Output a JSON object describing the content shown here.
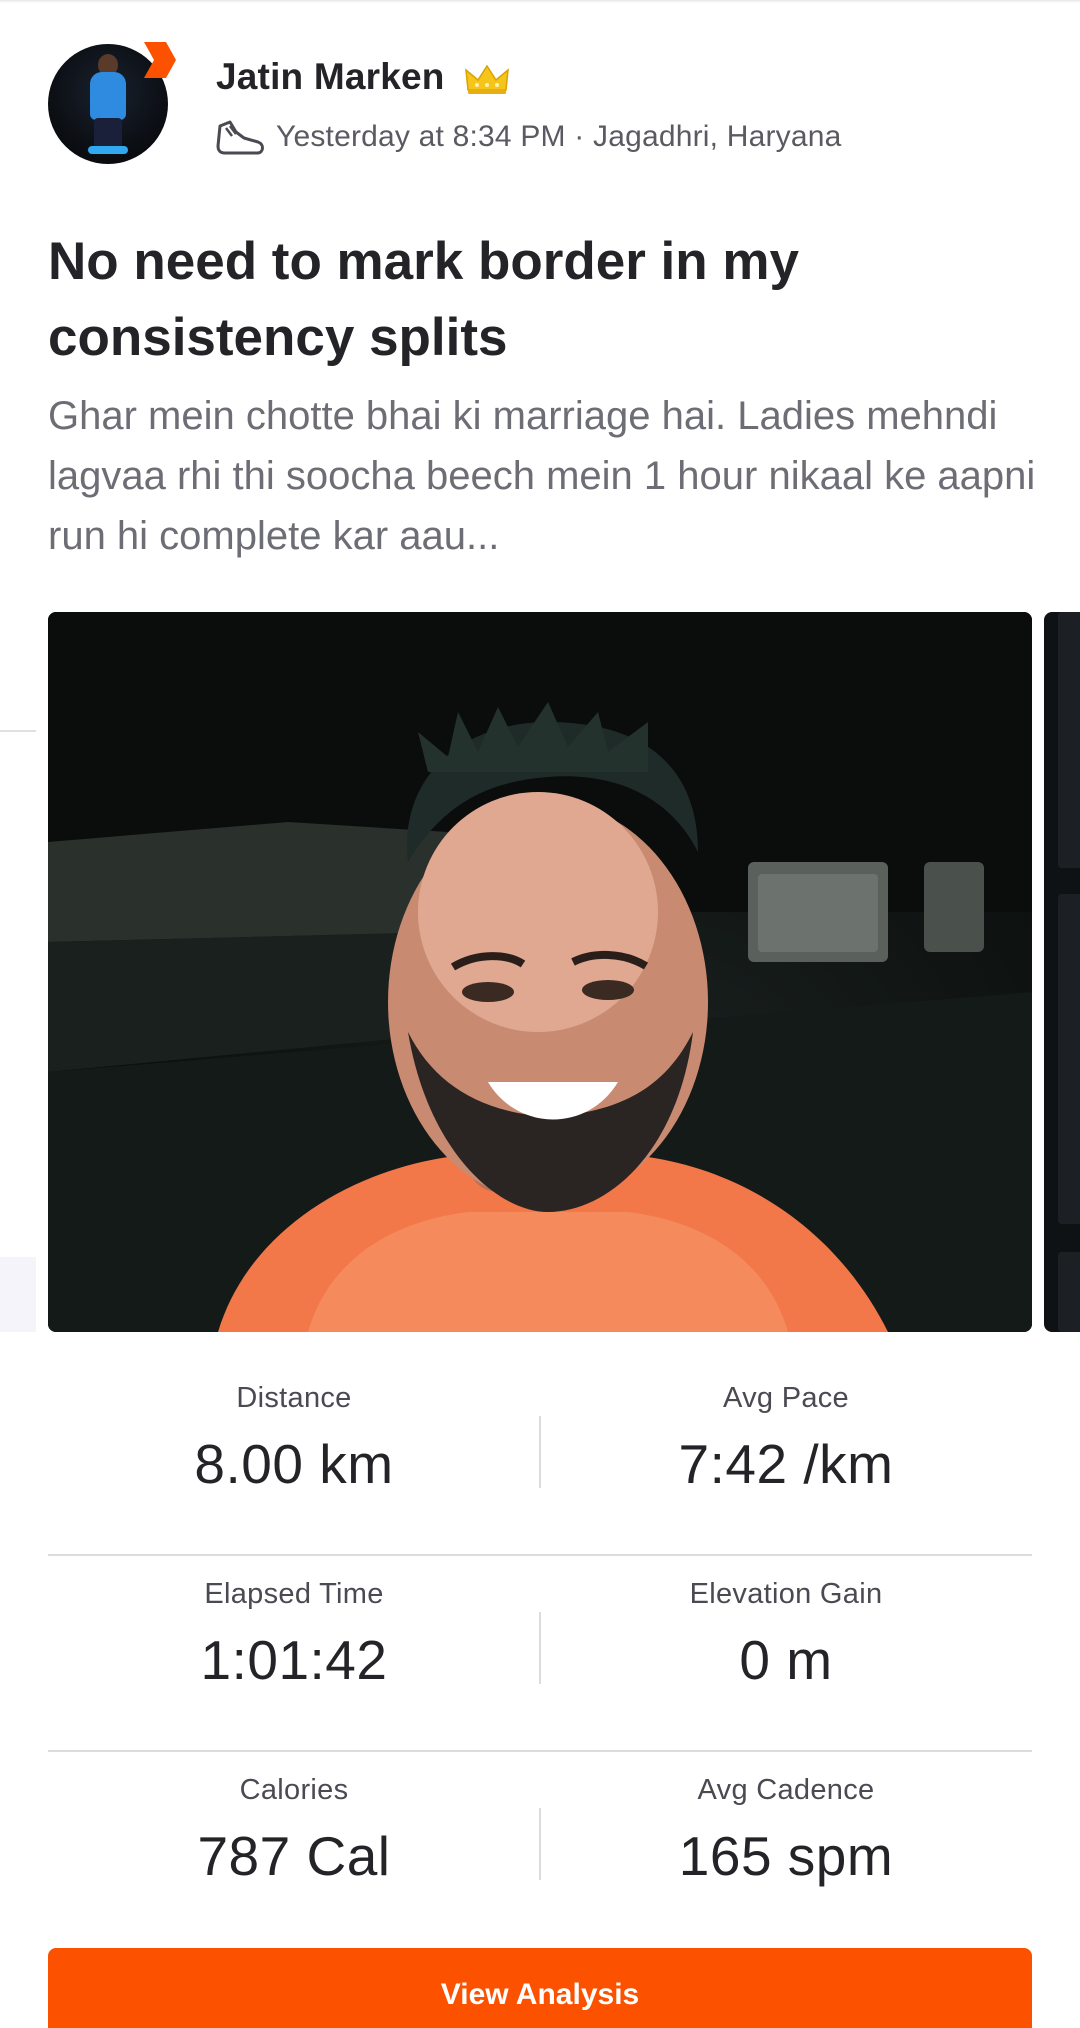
{
  "header": {
    "athlete_name": "Jatin Marken",
    "meta": "Yesterday at 8:34 PM · Jagadhri, Haryana",
    "icons": [
      "avatar",
      "strava-chevron-icon",
      "crown-icon",
      "shoe-icon"
    ]
  },
  "activity": {
    "title": "No need to mark border in my consistency splits",
    "description": "Ghar mein chotte bhai ki marriage hai. Ladies mehndi lagvaa rhi thi soocha beech mein 1 hour nikaal ke aapni run hi complete kar aau..."
  },
  "stats": [
    {
      "label": "Distance",
      "value": "8.00 km"
    },
    {
      "label": "Avg Pace",
      "value": "7:42 /km"
    },
    {
      "label": "Elapsed Time",
      "value": "1:01:42"
    },
    {
      "label": "Elevation Gain",
      "value": "0 m"
    },
    {
      "label": "Calories",
      "value": "787 Cal"
    },
    {
      "label": "Avg Cadence",
      "value": "165 spm"
    }
  ],
  "actions": {
    "view_analysis": "View Analysis"
  },
  "colors": {
    "accent": "#fc5200",
    "title_text": "#242428",
    "muted_text": "#6d6d75"
  }
}
